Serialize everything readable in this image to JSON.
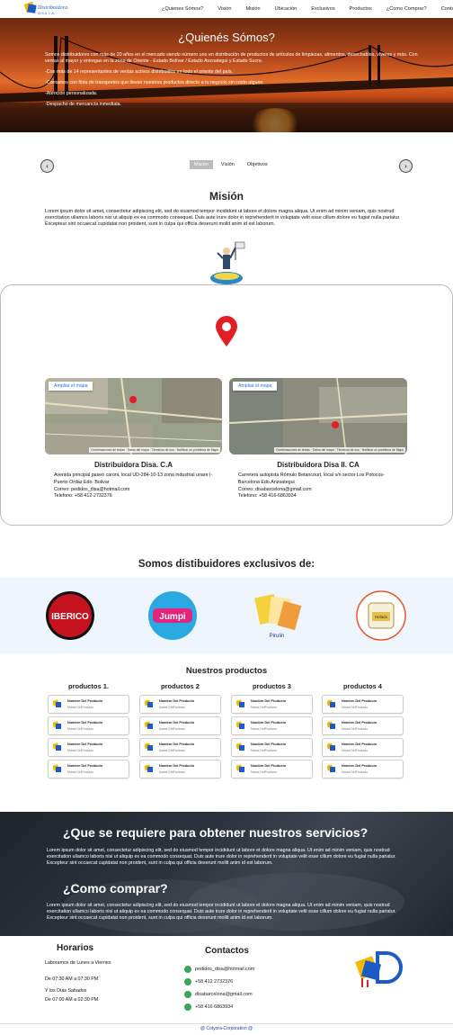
{
  "nav": {
    "logo_text": "Distribuidora",
    "items": [
      "¿Quienes Sómos?",
      "Visión",
      "Misión",
      "Ubicación",
      "Exclusivos",
      "Productos",
      "¿Como Comprar?",
      "Contactanos"
    ]
  },
  "hero": {
    "title": "¿Quienés Sómos?",
    "paragraphs": [
      "Somos distribuidores con más de 20 años en el mercado siendo número uno en distribución de productos de artículos de limpiezas, alimentos, desechables, víveres y más. Con ventas al mayor y entregas en la zona de Oriente - Estado Bolívar / Estado Anzoategui y Estado Sucre.",
      "-Con más de 14 representantes de ventas activos distribuidos en todo el oriente del país.",
      "-Contamos con flota de transportes que llevan nuestros productos directo a tu negocio sin costo alguno.",
      "-Atención personalizada.",
      "-Despacho de mercancía inmediata."
    ]
  },
  "carousel": {
    "tabs": [
      "Misión",
      "Visión",
      "Objetivos"
    ],
    "active_tab": 0,
    "prev_icon": "‹",
    "next_icon": "›"
  },
  "mision": {
    "title": "Misión",
    "text": "Lorem ipsum dolor sit amet, consectetur adipiscing elit, sed do eiusmod tempor incididunt ut labore et dolore magna aliqua. Ut enim ad minim veniam, quis nostrud exercitation ullamco laboris nisi ut aliquip ex ea commodo consequat. Duis aute irure dolor in reprehenderit in voluptate velit esse cillum dolore eu fugiat nulla pariatur. Excepteur sint occaecat cupidatat non proident, sunt in culpa qui officia deserunt mollit anim id est laborum."
  },
  "locations": [
    {
      "map_button": "Ampliar el mapa",
      "map_footer": "Combinaciones de teclas · Datos del mapa · Términos de uso · Notificar un problema de Maps",
      "name": "Distribuidora Disa. C.A",
      "address": "Avenida principal paseo caroni, local UD-284-10-13 zona industrial unare I-Puerto Ordaz Edo. Bolivar",
      "email": "Correo: pedidos_disa@hotmail.com",
      "phone": "Telefono: +58 412-2732376"
    },
    {
      "map_button": "Ampliar el mapa",
      "map_footer": "Combinaciones de teclas · Datos del mapa · Términos de uso · Notificar un problema de Maps",
      "name": "Distribuidora Disa II. CA",
      "address": "Carretera autopista Rómulo Betancourt, local s/n sector Los Potocos-Barcelona Edo.Anzoategui",
      "email": "Correo: disabarcelona@gmail.com",
      "phone": "Telefono: +58 416-6863934"
    }
  ],
  "exclusives": {
    "title": "Somos distibuidores exclusivos de:",
    "brands": [
      "IBERICO",
      "Jumpi",
      "Pirulin",
      "Helado"
    ]
  },
  "products": {
    "title": "Nuestros productos",
    "columns": [
      {
        "title": "productos 1.",
        "items": [
          {
            "name": "Nombre Del Producto",
            "brand": "Marca DelProducto"
          },
          {
            "name": "Nombre Del Producto",
            "brand": "Marca DelProducto"
          },
          {
            "name": "Nombre Del Producto",
            "brand": "Marca DelProducto"
          },
          {
            "name": "Nombre Del Producto",
            "brand": "Marca DelProducto"
          }
        ]
      },
      {
        "title": "productos 2",
        "items": [
          {
            "name": "Nombre Del Producto",
            "brand": "Marca DelProducto"
          },
          {
            "name": "Nombre Del Producto",
            "brand": "Marca DelProducto"
          },
          {
            "name": "Nombre Del Producto",
            "brand": "Marca DelProducto"
          },
          {
            "name": "Nombre Del Producto",
            "brand": "Marca DelProducto"
          }
        ]
      },
      {
        "title": "productos 3",
        "items": [
          {
            "name": "Nombre Del Producto",
            "brand": "Marca DelProducto"
          },
          {
            "name": "Nombre Del Producto",
            "brand": "Marca DelProducto"
          },
          {
            "name": "Nombre Del Producto",
            "brand": "Marca DelProducto"
          },
          {
            "name": "Nombre Del Producto",
            "brand": "Marca DelProducto"
          }
        ]
      },
      {
        "title": "productos 4",
        "items": [
          {
            "name": "Nombre Del Producto",
            "brand": "Marca DelProducto"
          },
          {
            "name": "Nombre Del Producto",
            "brand": "Marca DelProducto"
          },
          {
            "name": "Nombre Del Producto",
            "brand": "Marca DelProducto"
          },
          {
            "name": "Nombre Del Producto",
            "brand": "Marca DelProducto"
          }
        ]
      }
    ]
  },
  "requirements": {
    "title": "¿Que se requiere para obtener nuestros servicios?",
    "text": "Lorem ipsum dolor sit amet, consectetur adipiscing elit, sed do eiusmod tempor incididunt ut labore et dolore magna aliqua. Ut enim ad minim veniam, quis nostrud exercitation ullamco laboris nisi ut aliquip ex ea commodo consequat. Duis aute irure dolor in reprehenderit in voluptate velit esse cillum dolore eu fugiat nulla pariatur. Excepteur sint occaecat cupidatat non proident, sunt in culpa qui officia deserunt mollit anim id est laborum.",
    "how_title": "¿Como comprar?",
    "how_text": "Lorem ipsum dolor sit amet, consectetur adipiscing elit, sed do eiusmod tempor incididunt ut labore et dolore magna aliqua. Ut enim ad minim veniam, quis nostrud exercitation ullamco laboris nisi ut aliquip ex ea commodo consequat. Duis aute irure dolor in reprehenderit in voluptate velit esse cillum dolore eu fugiat nulla pariatur. Excepteur sint occaecat cupidatat non proident, sunt in culpa qui officia deserunt mollit anim id est laborum."
  },
  "footer": {
    "hours_title": "Horarios",
    "hours_line1": "Laboramos de Lunes a Viernes",
    "hours_line2": "De 07:30 AM a 07:30 PM",
    "hours_line3": "Y los Días Sabados",
    "hours_line4": "De 07:00 AM a 02:30 PM",
    "contacts_title": "Contactos",
    "contacts": [
      {
        "icon": "email-icon",
        "text": "pedidos_disa@hotmail.com"
      },
      {
        "icon": "whatsapp-icon",
        "text": "+58 412 2732376"
      },
      {
        "icon": "email-icon",
        "text": "disabarcelona@gmail.com"
      },
      {
        "icon": "whatsapp-icon",
        "text": "+58 416 6863934"
      }
    ],
    "copyright": "@ Cotyora-Corporation @"
  }
}
